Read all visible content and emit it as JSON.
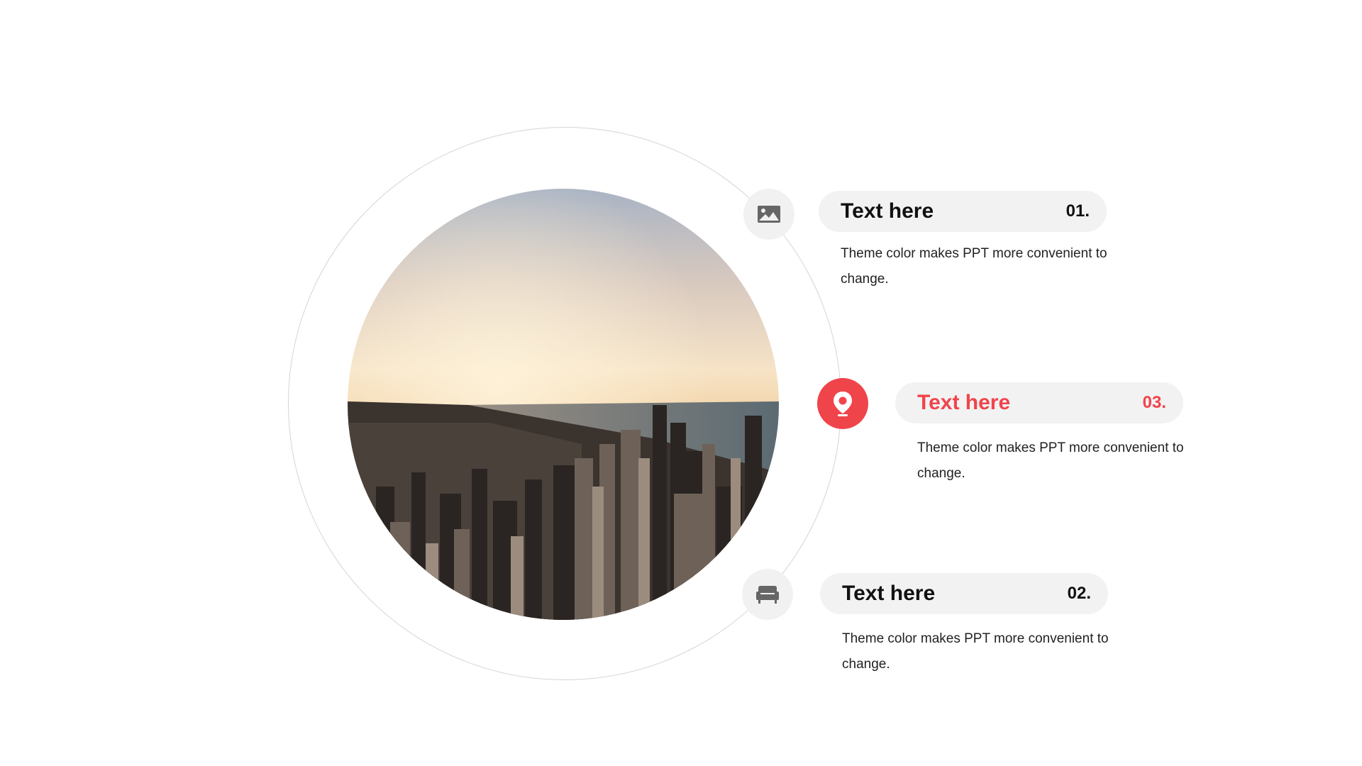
{
  "colors": {
    "accent": "#f0444b",
    "ring": "#d4d4d4",
    "pill_bg": "#f2f2f2",
    "icon_bg": "#f1f1f1",
    "text": "#111111"
  },
  "items": [
    {
      "icon": "image-icon",
      "title": "Text here",
      "number": "01.",
      "description": "Theme color makes PPT more convenient to change."
    },
    {
      "icon": "location-pin-icon",
      "title": "Text here",
      "number": "03.",
      "description": "Theme color makes PPT more convenient to change."
    },
    {
      "icon": "sofa-icon",
      "title": "Text here",
      "number": "02.",
      "description": "Theme color makes PPT more convenient to change."
    }
  ]
}
